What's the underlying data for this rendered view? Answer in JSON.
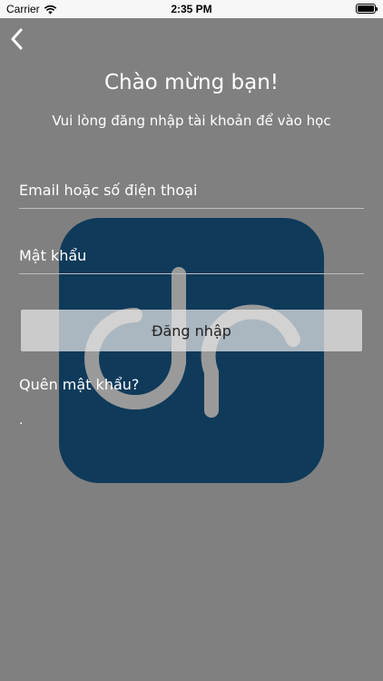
{
  "status_bar": {
    "carrier": "Carrier",
    "time": "2:35 PM"
  },
  "header": {
    "back_icon": "chevron-left-icon"
  },
  "main": {
    "title": "Chào mừng bạn!",
    "subtitle": "Vui lòng đăng nhập tài khoản để vào học",
    "email_placeholder": "Email hoặc số điện thoại",
    "password_placeholder": "Mật khẩu",
    "login_label": "Đăng nhập",
    "forgot_label": "Quên mật khẩu?",
    "footer_text": "."
  },
  "colors": {
    "background": "#808080",
    "logo_bg": "#103a5a",
    "logo_stroke": "#9a9a9a"
  }
}
